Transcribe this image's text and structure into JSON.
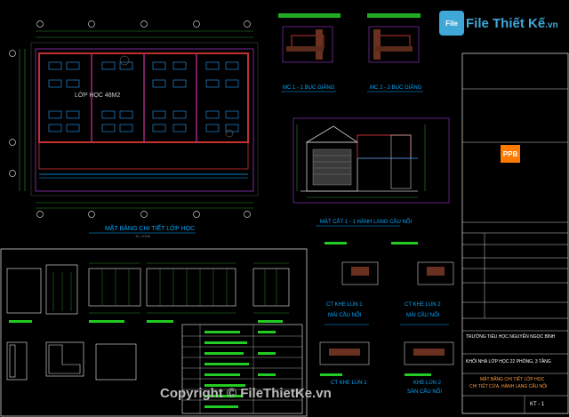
{
  "watermark": {
    "logo_badge": "File",
    "logo_text_main": "File Thiết Kế",
    "logo_text_suffix": ".vn",
    "copyright": "Copyright © FileThietKe.vn"
  },
  "drawing": {
    "plan_title": "MẶT BẰNG CHI TIẾT LỚP HỌC",
    "plan_scale": "TL: 1/100",
    "room_label": "LỚP HỌC 48M2",
    "mc1_title": "MC 1 - 1 BỤC GIẢNG",
    "mc2_title": "MC 2 - 2 BỤC GIẢNG",
    "section_title": "MẶT CẮT 1 - 1 HÀNH LANG CẦU NỐI",
    "ct1_title": "CT KHE LÚN 1",
    "ct1_sub": "MÁI CẦU NỐI",
    "ct2_title": "CT KHE LÚN 2",
    "ct2_sub": "MÁI CẦU NỐI",
    "ct3_title": "CT KHE LÚN 1",
    "ct4_title": "KHE LÚN 2",
    "ct4_sub": "SÀN CẦU NỐI",
    "scale_small": "TL: 1/10"
  },
  "title_block": {
    "company_logo": "PPB",
    "project_line1": "TRƯỜNG TIỂU HỌC NGUYỄN NGỌC BÌNH",
    "project_line2": "KHỐI NHÀ LỚP HỌC 22 PHÒNG, 3 TẦNG",
    "sheet_title_line1": "MẶT BẰNG CHI TIẾT LỚP HỌC",
    "sheet_title_line2": "CHI TIẾT CỬA, HÀNH LANG CẦU NỐI",
    "sheet_no": "KT - 1"
  }
}
